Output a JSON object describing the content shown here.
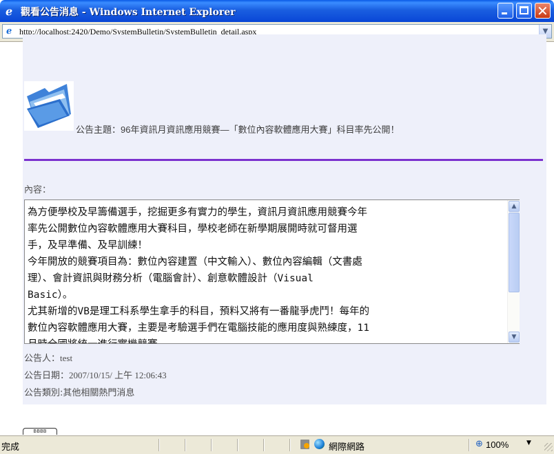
{
  "window": {
    "title": "觀看公告消息 - Windows Internet Explorer",
    "icon": "ie-icon"
  },
  "address": {
    "url": "http://localhost:2420/Demo/SystemBulletin/SystemBulletin_detail.aspx"
  },
  "bulletin": {
    "subject": "公告主題：96年資訊月資訊應用競賽—「數位內容軟體應用大賽」科目率先公開！",
    "content_label": "內容：",
    "content_lines": [
      "為方便學校及早籌備選手，挖掘更多有實力的學生，資訊月資訊應用競賽今年",
      "率先公開數位內容軟體應用大賽科目，學校老師在新學期展開時就可督用選",
      "手，及早準備、及早訓練！",
      "今年開放的競賽項目為：數位內容建置（中文輸入）、數位內容編輯（文書處",
      "理）、會計資訊與財務分析（電腦會計）、創意軟體設計（Visual",
      "Basic）。",
      "尤其新增的VB是理工科系學生拿手的科目，預料又將有一番龍爭虎鬥！每年的",
      "數位內容軟體應用大賽，主要是考驗選手們在電腦技能的應用度與熟練度，11",
      "月時全國將統一進行實機競賽"
    ],
    "publisher_label": "公告人：",
    "publisher": "test",
    "date_label": "公告日期：",
    "date": "2007/10/15/ 上午 12:06:43",
    "category_label": "公告類別:",
    "category": "其他相關熱門消息",
    "partial_button": "BBBB"
  },
  "status": {
    "text": "完成",
    "zone": "網際網路",
    "zoom": "100%"
  },
  "colors": {
    "divider": "#7b31ce",
    "panel": "#eef0fa",
    "titlebar": "#0a5ae6"
  }
}
